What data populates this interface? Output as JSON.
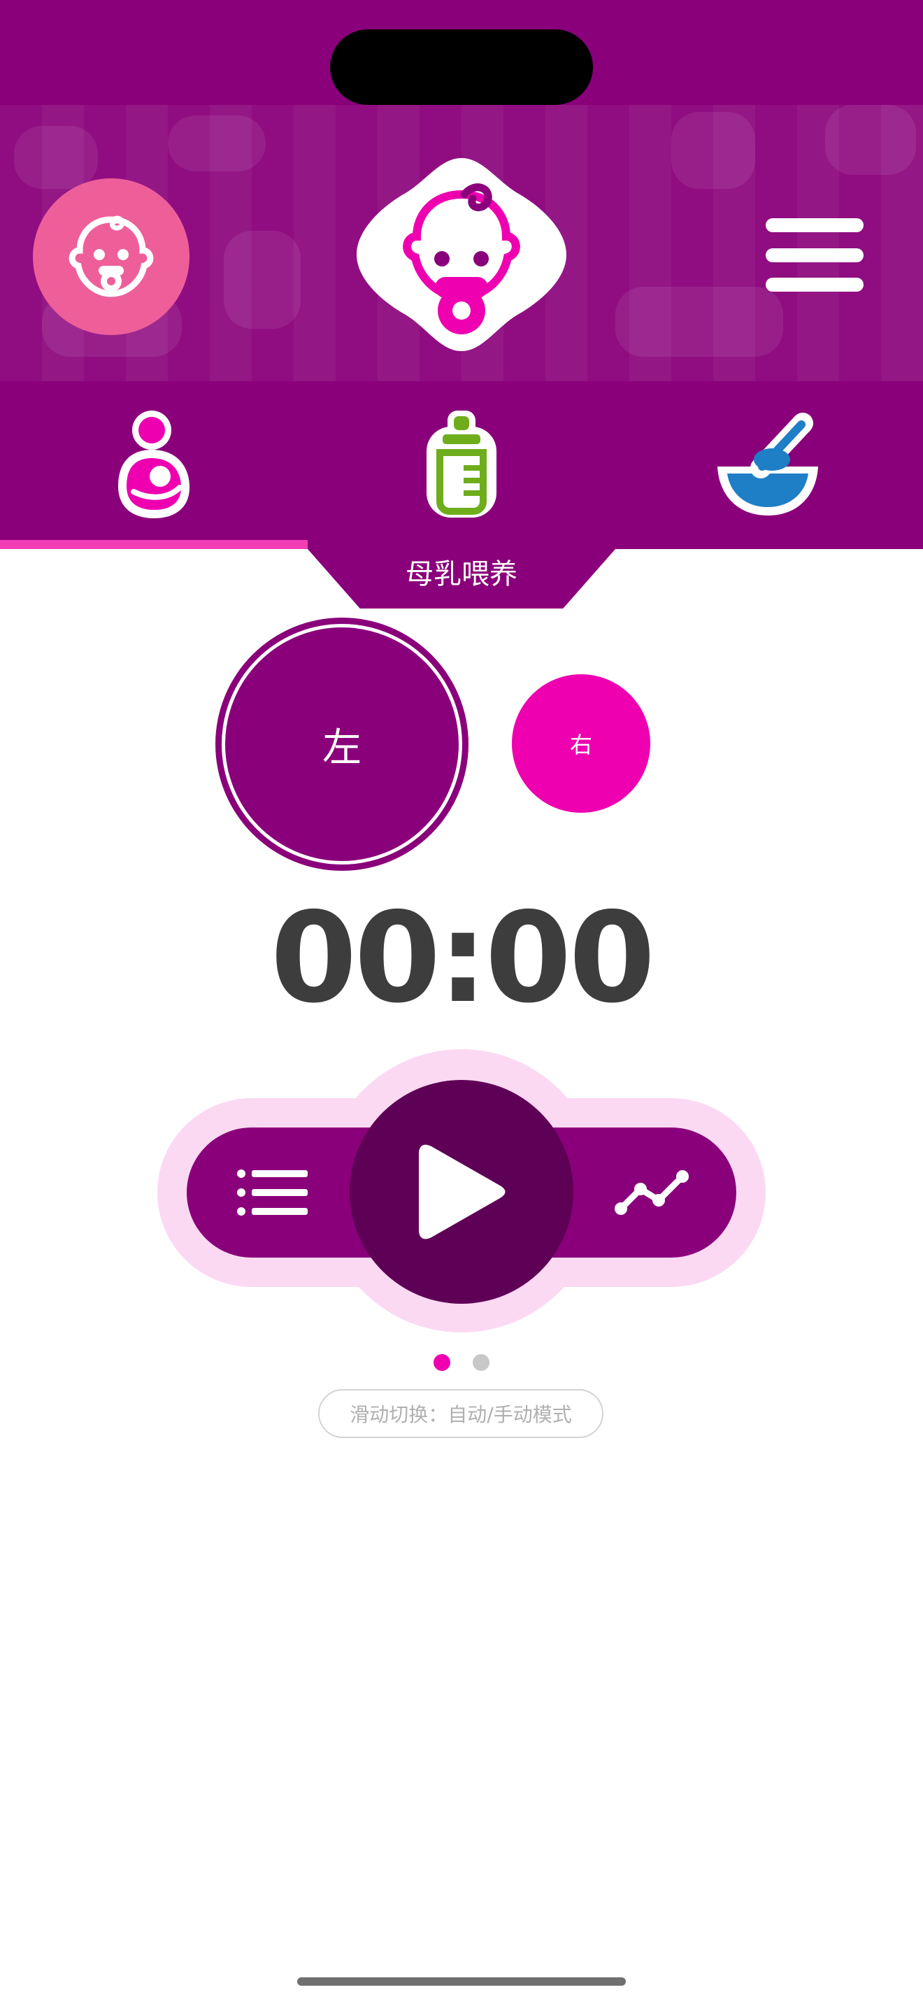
{
  "header": {
    "colors": {
      "primary": "#8a007a",
      "accent": "#ee00b0",
      "pink_soft": "#fbd9f3",
      "avatar_bg": "#ee5f9a"
    },
    "avatar_icon": "baby-face-icon",
    "logo_icon": "baby-face-pacifier-logo",
    "menu_icon": "hamburger-menu-icon"
  },
  "tabs": [
    {
      "icon": "breastfeeding-icon",
      "selected": true
    },
    {
      "icon": "baby-bottle-icon",
      "selected": false
    },
    {
      "icon": "baby-food-bowl-icon",
      "selected": false
    }
  ],
  "tab_title": "母乳喂养",
  "sides": {
    "left": "左",
    "right": "右"
  },
  "timer": "00:00",
  "controls": {
    "list_icon": "list-icon",
    "play_icon": "play-icon",
    "stats_icon": "line-chart-icon"
  },
  "pager": {
    "current": 1,
    "total": 2
  },
  "hint": "滑动切换：自动/手动模式"
}
